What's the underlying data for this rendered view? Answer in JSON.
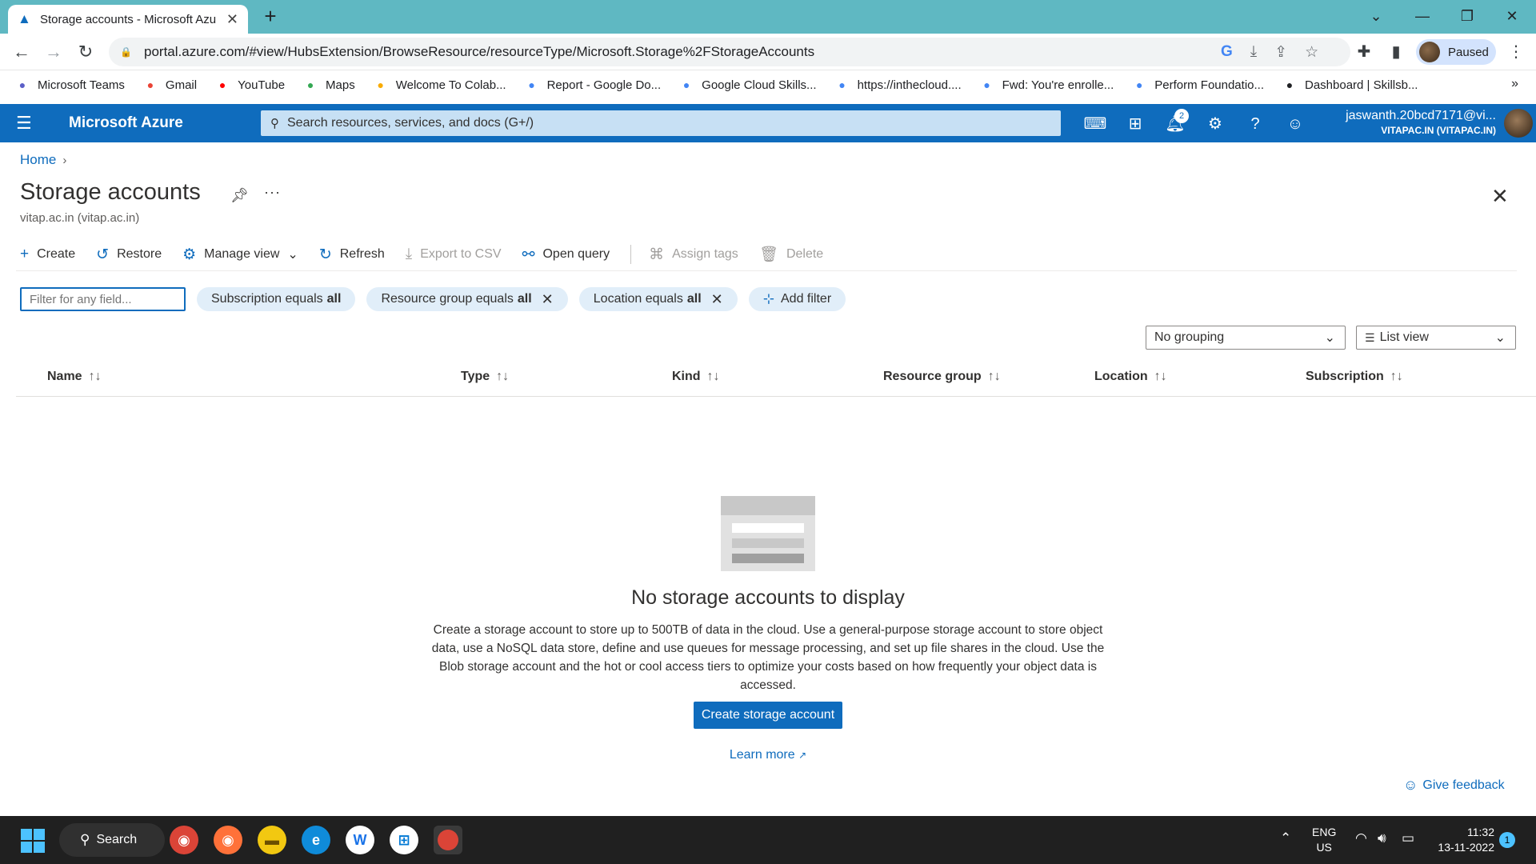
{
  "browser": {
    "tab_title": "Storage accounts - Microsoft Azu",
    "url": "portal.azure.com/#view/HubsExtension/BrowseResource/resourceType/Microsoft.Storage%2FStorageAccounts",
    "profile_status": "Paused",
    "bookmarks": [
      {
        "label": "Microsoft Teams",
        "icon": "teams-icon",
        "color": "#5b5fc7"
      },
      {
        "label": "Gmail",
        "icon": "gmail-icon",
        "color": "#ea4335"
      },
      {
        "label": "YouTube",
        "icon": "youtube-icon",
        "color": "#ff0000"
      },
      {
        "label": "Maps",
        "icon": "maps-icon",
        "color": "#34a853"
      },
      {
        "label": "Welcome To Colab...",
        "icon": "colab-icon",
        "color": "#f9ab00"
      },
      {
        "label": "Report - Google Do...",
        "icon": "docs-icon",
        "color": "#4285f4"
      },
      {
        "label": "Google Cloud Skills...",
        "icon": "cloud-icon",
        "color": "#4285f4"
      },
      {
        "label": "https://inthecloud....",
        "icon": "cloud-icon",
        "color": "#4285f4"
      },
      {
        "label": "Fwd: You're enrolle...",
        "icon": "google-icon",
        "color": "#4285f4"
      },
      {
        "label": "Perform Foundatio...",
        "icon": "cloud-icon",
        "color": "#4285f4"
      },
      {
        "label": "Dashboard | Skillsb...",
        "icon": "skillsbuilder-icon",
        "color": "#202124"
      }
    ]
  },
  "azure": {
    "brand": "Microsoft Azure",
    "search_placeholder": "Search resources, services, and docs (G+/)",
    "notification_count": "2",
    "account_name": "jaswanth.20bcd7171@vi...",
    "account_directory": "VITAPAC.IN (VITAPAC.IN)"
  },
  "page": {
    "breadcrumb_home": "Home",
    "title": "Storage accounts",
    "subtitle": "vitap.ac.in (vitap.ac.in)",
    "commands": {
      "create": "Create",
      "restore": "Restore",
      "manage_view": "Manage view",
      "refresh": "Refresh",
      "export_csv": "Export to CSV",
      "open_query": "Open query",
      "assign_tags": "Assign tags",
      "delete": "Delete"
    },
    "filter_placeholder": "Filter for any field...",
    "filters": {
      "subscription_label": "Subscription equals",
      "subscription_value": "all",
      "resource_group_label": "Resource group equals",
      "resource_group_value": "all",
      "location_label": "Location equals",
      "location_value": "all",
      "add_filter": "Add filter"
    },
    "grouping": "No grouping",
    "view_mode": "List view",
    "columns": [
      "Name",
      "Type",
      "Kind",
      "Resource group",
      "Location",
      "Subscription"
    ],
    "empty": {
      "title": "No storage accounts to display",
      "description": "Create a storage account to store up to 500TB of data in the cloud. Use a general-purpose storage account to store object data, use a NoSQL data store, define and use queues for message processing, and set up file shares in the cloud. Use the Blob storage account and the hot or cool access tiers to optimize your costs based on how frequently your object data is accessed.",
      "button": "Create storage account",
      "learn_more": "Learn more"
    },
    "feedback": "Give feedback"
  },
  "taskbar": {
    "search_label": "Search",
    "lang_line1": "ENG",
    "lang_line2": "US",
    "time": "11:32",
    "date": "13-11-2022",
    "notification_count": "1"
  },
  "colors": {
    "azure_blue": "#0f6cbd",
    "tab_strip": "#5fb8c2",
    "pill_bg": "#e1eef9"
  }
}
